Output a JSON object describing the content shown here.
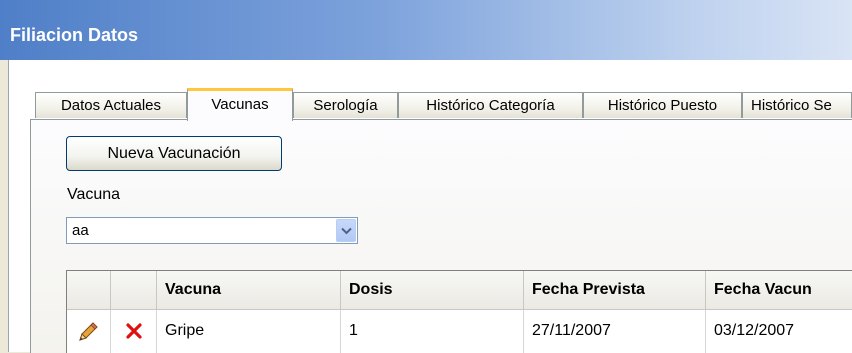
{
  "window": {
    "title": "Filiacion Datos"
  },
  "tabs": [
    {
      "label": "Datos Actuales"
    },
    {
      "label": "Vacunas"
    },
    {
      "label": "Serología"
    },
    {
      "label": "Histórico Categoría"
    },
    {
      "label": "Histórico Puesto"
    },
    {
      "label": "Histórico Se"
    }
  ],
  "active_tab": "Vacunas",
  "form": {
    "new_button_label": "Nueva Vacunación",
    "vacuna_label": "Vacuna",
    "vacuna_value": "aa"
  },
  "table": {
    "columns": [
      "Vacuna",
      "Dosis",
      "Fecha Prevista",
      "Fecha Vacun"
    ],
    "rows": [
      {
        "vacuna": "Gripe",
        "dosis": "1",
        "fecha_prevista": "27/11/2007",
        "fecha_vacunacion": "03/12/2007"
      }
    ]
  },
  "icons": {
    "edit": "pencil-icon",
    "delete": "red-x-icon",
    "dropdown": "chevron-down-icon"
  },
  "colors": {
    "title_bar": "#4f7fc8",
    "active_tab_accent": "#ffc83c",
    "delete_icon": "#e01010"
  }
}
